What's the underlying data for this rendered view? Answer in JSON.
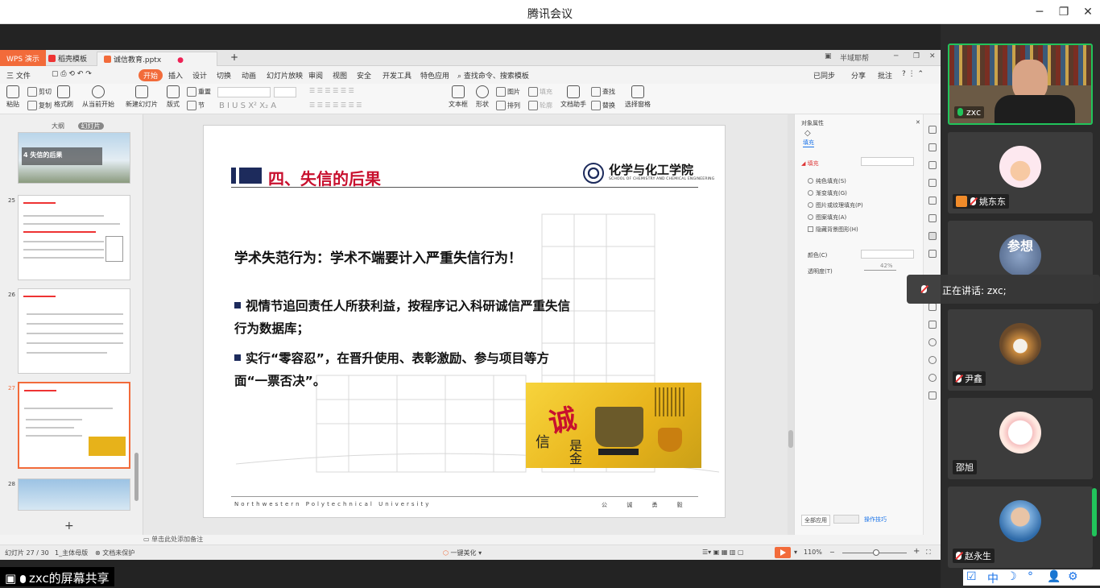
{
  "window": {
    "title": "腾讯会议"
  },
  "wps": {
    "tabs": [
      "WPS 演示",
      "稻壳模板",
      "诚信教育.pptx"
    ],
    "top_right": "半域耶帮",
    "menu": [
      "三 文件",
      "开始",
      "插入",
      "设计",
      "切换",
      "动画",
      "幻灯片放映",
      "审阅",
      "视图",
      "安全",
      "开发工具",
      "特色应用",
      "查找命令、搜索模板"
    ],
    "menu_right": [
      "已同步",
      "分享",
      "批注"
    ],
    "ribbon": {
      "paste": "粘贴",
      "cut": "剪切",
      "copy": "复制",
      "format_painter": "格式刷",
      "play": "从当前开始",
      "new_slide": "新建幻灯片",
      "layout": "版式",
      "section": "节",
      "reset": "重置",
      "textbox": "文本框",
      "shape": "形状",
      "arrange": "排列",
      "picture": "图片",
      "fill": "填充",
      "outline": "轮廓",
      "doc_helper": "文档助手",
      "find": "查找",
      "replace": "替换",
      "select_pane": "选择窗格"
    },
    "panel_tabs": [
      "大纲",
      "幻灯片"
    ],
    "thumbs": [
      {
        "num": "",
        "title": "4  失信的后果"
      },
      {
        "num": "25",
        "title": ""
      },
      {
        "num": "26",
        "title": ""
      },
      {
        "num": "27",
        "title": ""
      },
      {
        "num": "28",
        "title": ""
      }
    ],
    "slide": {
      "title": "四、失信的后果",
      "school_name": "化学与化工学院",
      "school_en": "SCHOOL OF CHEMISTRY AND CHEMICAL ENGINEERING",
      "heading": "学术失范行为：学术不端要计入严重失信行为！",
      "bullet1": "视情节追回责任人所获利益，按程序记入科研诚信严重失信行为数据库；",
      "bullet2": "实行“零容忍”，在晋升使用、表彰激励、参与项目等方面“一票否决”。",
      "img_text_big": "诚",
      "img_text_a": "信",
      "img_text_b": "是金",
      "footer_left": "Northwestern Polytechnical University",
      "footer_right": "公 诚 勇 毅"
    },
    "props": {
      "title": "对象属性",
      "tab": "填充",
      "section": "填充",
      "options": [
        "纯色填充(S)",
        "渐变填充(G)",
        "图片或纹理填充(P)",
        "图案填充(A)"
      ],
      "hide_bg": "隐藏背景图形(H)",
      "color_label": "颜色(C)",
      "transparency_label": "透明度(T)",
      "transparency_value": "42%",
      "apply_all": "全部应用",
      "tips": "操作技巧"
    },
    "notes": "单击此处添加备注",
    "status": {
      "slide": "幻灯片 27 / 30",
      "theme": "1_主体母版",
      "protect": "文档未保护",
      "beautify": "一键美化",
      "zoom": "110%"
    }
  },
  "participants": [
    {
      "name": "zxc",
      "speaking": true
    },
    {
      "name": "姚东东",
      "host": true
    },
    {
      "name": "参想"
    },
    {
      "name": "尹鑫"
    },
    {
      "name": "邵旭"
    },
    {
      "name": "赵永生"
    }
  ],
  "toast": "正在讲话: zxc;",
  "share_label": "zxc的屏幕共享",
  "tray": [
    "中",
    "☽",
    "°",
    "⚙"
  ],
  "colors": {
    "wps_orange": "#f26b3a",
    "slide_title_red": "#c8102e",
    "speaking_green": "#21c45b",
    "navy": "#1d2b5c"
  }
}
